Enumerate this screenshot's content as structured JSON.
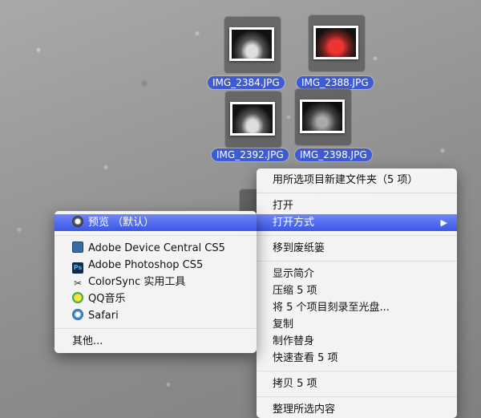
{
  "desktop": {
    "icons": [
      {
        "name": "IMG_2384.JPG",
        "thumb": "silver-car"
      },
      {
        "name": "IMG_2388.JPG",
        "thumb": "red-car"
      },
      {
        "name": "IMG_2392.JPG",
        "thumb": "silver-car"
      },
      {
        "name": "IMG_2398.JPG",
        "thumb": "dark-car"
      }
    ]
  },
  "context_menu": {
    "new_folder": "用所选项目新建文件夹（5 项）",
    "open": "打开",
    "open_with": "打开方式",
    "move_to_trash": "移到废纸篓",
    "get_info": "显示简介",
    "compress": "压缩 5 项",
    "burn": "将 5 个项目刻录至光盘...",
    "duplicate": "复制",
    "make_alias": "制作替身",
    "quick_look": "快速查看 5 项",
    "copy": "拷贝 5 项",
    "clean_up": "整理所选内容"
  },
  "open_with_menu": {
    "preview": "预览 （默认）",
    "apps": [
      "Adobe Device Central CS5",
      "Adobe Photoshop CS5",
      "ColorSync 实用工具",
      "QQ音乐",
      "Safari"
    ],
    "other": "其他..."
  },
  "colors": {
    "highlight": "#3b57e6",
    "label_selected": "#3f5bd4"
  }
}
